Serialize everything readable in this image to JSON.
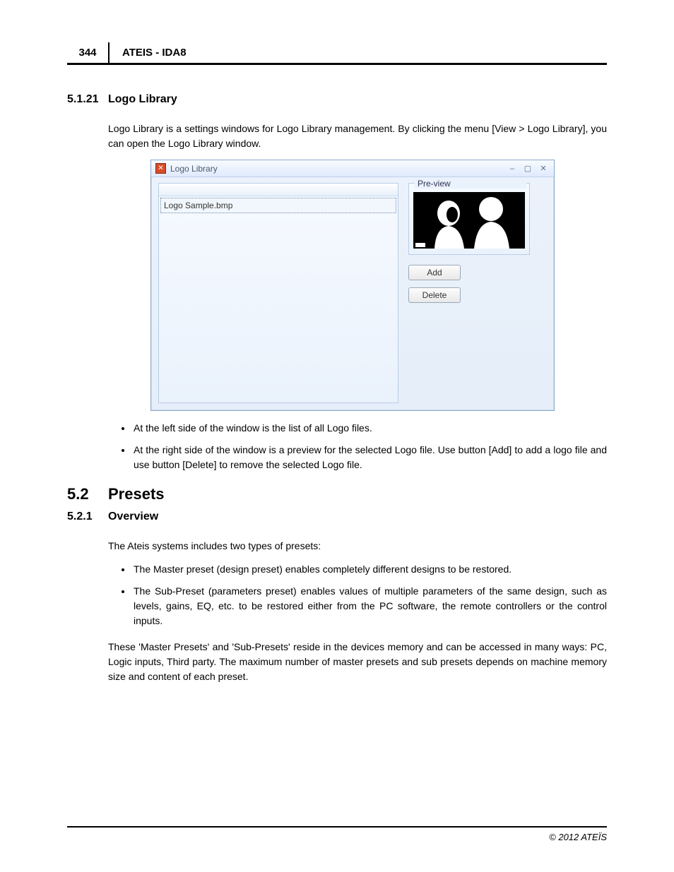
{
  "header": {
    "page_number": "344",
    "doc_title": "ATEIS - IDA8"
  },
  "sections": {
    "s1": {
      "num": "5.1.21",
      "title": "Logo Library"
    },
    "s2": {
      "num": "5.2",
      "title": "Presets"
    },
    "s3": {
      "num": "5.2.1",
      "title": "Overview"
    }
  },
  "para": {
    "p1": "Logo Library is a settings windows for Logo Library management. By clicking the menu [View > Logo Library], you can open the Logo Library window.",
    "b1": "At the left side of the window is the list of all Logo files.",
    "b2": "At the right side of the window is a preview for the selected Logo file. Use button [Add] to add a logo file and use button [Delete] to remove the selected Logo file.",
    "p2": "The Ateis systems includes two types of presets:",
    "b3": "The Master preset (design preset) enables completely different designs to be restored.",
    "b4": "The Sub-Preset (parameters preset) enables values of multiple parameters of the same design, such as levels, gains, EQ, etc. to be restored either from the PC software, the remote controllers or the control inputs.",
    "p3": "These 'Master Presets' and 'Sub-Presets' reside in the devices memory and can be accessed in many ways: PC, Logic inputs, Third party. The maximum number of master presets and sub presets depends on machine memory size and content of each preset."
  },
  "window": {
    "title": "Logo Library",
    "file_row": "Logo Sample.bmp",
    "preview_label": "Pre-view",
    "add_label": "Add",
    "delete_label": "Delete"
  },
  "footer": "© 2012 ATEÏS"
}
